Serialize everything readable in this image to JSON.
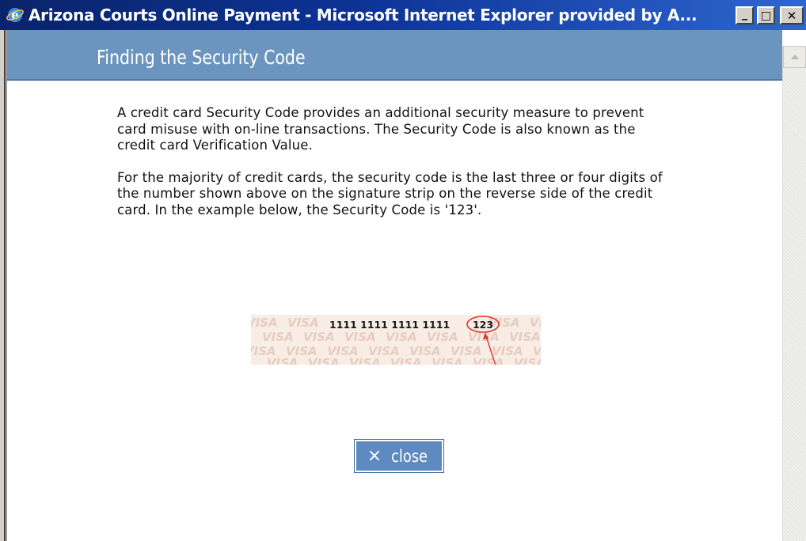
{
  "window": {
    "title": "Arizona Courts Online Payment - Microsoft Internet Explorer provided by A...",
    "controls": {
      "minimize": "_",
      "maximize": "□",
      "close": "✕"
    }
  },
  "page": {
    "heading": "Finding the Security Code",
    "paragraphs": [
      "A credit card Security Code provides an additional security measure to prevent card misuse with on-line transactions. The Security Code is also known as the credit card Verification Value.",
      "For the majority of credit cards, the security code is the last three or four digits of the number shown above on the signature strip on the reverse side of the credit card. In the example below, the Security Code is '123'."
    ],
    "card_example": {
      "card_number": "1111 1111 1111 1111",
      "security_code": "123",
      "watermark": "VISA"
    },
    "close_button": {
      "icon": "×",
      "label": "close"
    }
  },
  "colors": {
    "title_bar": "#0a246a",
    "header_band": "#6b95bf",
    "close_button": "#5e8bbf",
    "highlight": "#e03030"
  }
}
